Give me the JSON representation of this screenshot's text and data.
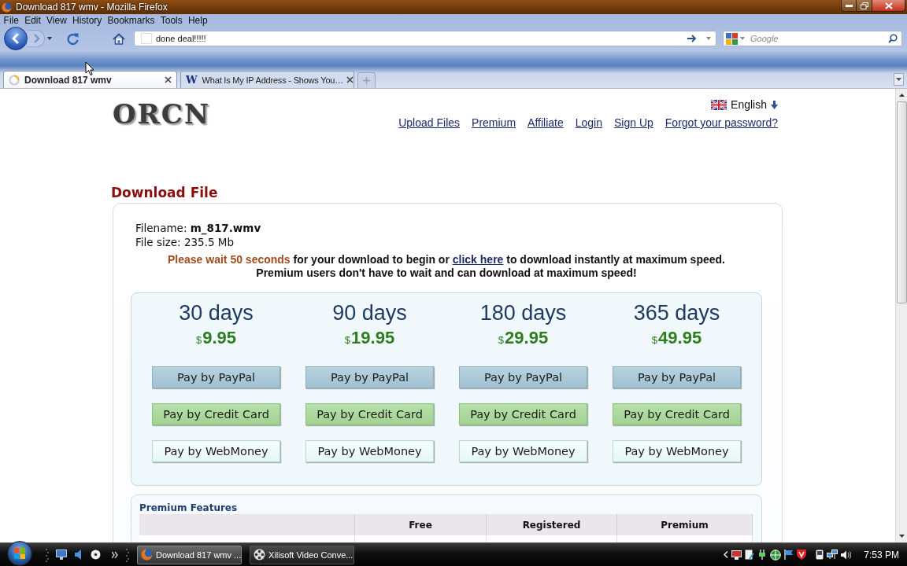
{
  "window": {
    "title": "Download 817 wmv - Mozilla Firefox"
  },
  "menu_bar": [
    "File",
    "Edit",
    "View",
    "History",
    "Bookmarks",
    "Tools",
    "Help"
  ],
  "nav_bar": {
    "forward_disabled": true,
    "url": "done deal!!!!!",
    "search": {
      "placeholder": "Google"
    }
  },
  "tabs": [
    {
      "label": "Download 817 wmv",
      "selected": true,
      "loading": true
    },
    {
      "label": "What Is My IP Address - Shows You…",
      "selected": false,
      "loading": false,
      "favicon": "W"
    }
  ],
  "page": {
    "logo": "ORCN",
    "language": "English",
    "nav_links": [
      "Upload Files",
      "Premium",
      "Affiliate",
      "Login",
      "Sign Up",
      "Forgot your password?"
    ],
    "heading": "Download File",
    "file": {
      "name_label": "Filename:",
      "name": "m_817.wmv",
      "size_label": "File size:",
      "size": "235.5 Mb"
    },
    "wait_notice": {
      "highlight": "Please wait 50 seconds",
      "text_before_link": "for your download to begin or",
      "link": "click here",
      "text_after_link": "to download instantly at maximum speed."
    },
    "premium_notice": "Premium users don't have to wait and can download at maximum speed!",
    "plans": [
      {
        "duration": "30 days",
        "currency": "$",
        "amount": "9.95",
        "buttons": [
          {
            "kind": "paypal",
            "label": "Pay by PayPal"
          },
          {
            "kind": "credit_card",
            "label": "Pay by Credit Card"
          },
          {
            "kind": "webmoney",
            "label": "Pay by WebMoney"
          }
        ]
      },
      {
        "duration": "90 days",
        "currency": "$",
        "amount": "19.95",
        "buttons": [
          {
            "kind": "paypal",
            "label": "Pay by PayPal"
          },
          {
            "kind": "credit_card",
            "label": "Pay by Credit Card"
          },
          {
            "kind": "webmoney",
            "label": "Pay by WebMoney"
          }
        ]
      },
      {
        "duration": "180 days",
        "currency": "$",
        "amount": "29.95",
        "buttons": [
          {
            "kind": "paypal",
            "label": "Pay by PayPal"
          },
          {
            "kind": "credit_card",
            "label": "Pay by Credit Card"
          },
          {
            "kind": "webmoney",
            "label": "Pay by WebMoney"
          }
        ]
      },
      {
        "duration": "365 days",
        "currency": "$",
        "amount": "49.95",
        "buttons": [
          {
            "kind": "paypal",
            "label": "Pay by PayPal"
          },
          {
            "kind": "credit_card",
            "label": "Pay by Credit Card"
          },
          {
            "kind": "webmoney",
            "label": "Pay by WebMoney"
          }
        ]
      }
    ],
    "features": {
      "title": "Premium Features",
      "columns": [
        "Free",
        "Registered",
        "Premium"
      ]
    }
  },
  "taskbar": {
    "tasks": [
      {
        "label": "Download 817 wmv ...",
        "selected": true,
        "kind": "firefox"
      },
      {
        "label": "Xilisoft Video Conve...",
        "selected": false,
        "kind": "converter"
      }
    ],
    "clock": "7:53 PM"
  }
}
